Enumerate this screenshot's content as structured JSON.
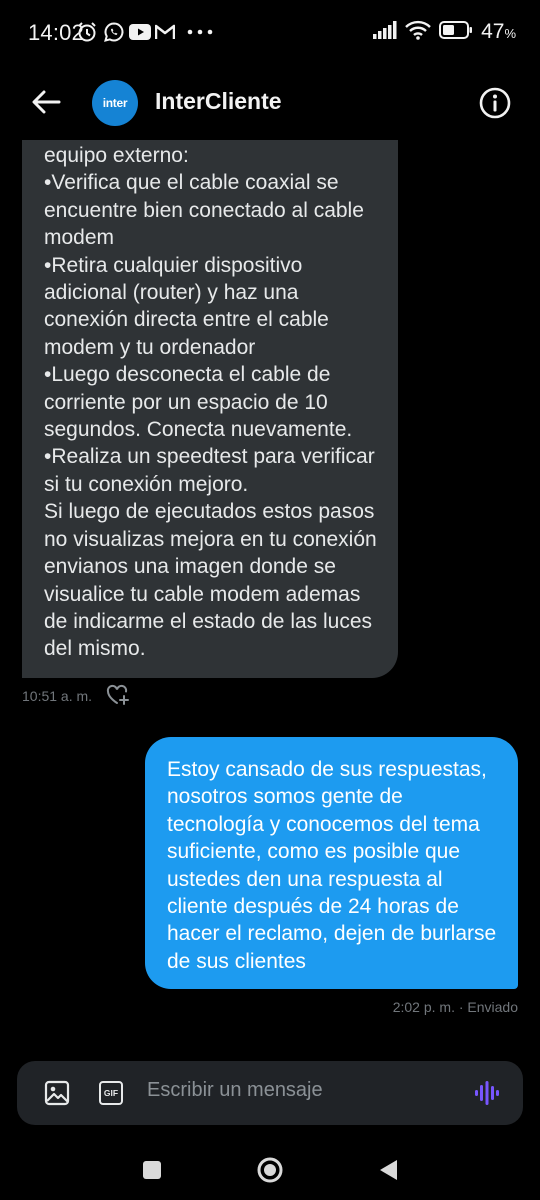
{
  "status_bar": {
    "time": "14:02",
    "battery_percent": "47",
    "notification_icons": [
      "alarm-icon",
      "whatsapp-icon",
      "youtube-icon",
      "gmail-icon",
      "more-dots-icon"
    ],
    "system_icons": [
      "signal-icon",
      "wifi-icon",
      "battery-icon"
    ]
  },
  "header": {
    "contact_name": "InterCliente",
    "avatar_text": "inter",
    "avatar_color": "#1583d4"
  },
  "messages": {
    "incoming": {
      "lines": [
        "equipo externo:",
        "•Verifica que el cable coaxial se",
        "encuentre bien conectado al cable",
        "modem",
        "•Retira cualquier dispositivo",
        "adicional (router) y haz una",
        "conexión directa entre el cable",
        "modem y tu ordenador",
        "•Luego desconecta el cable de",
        "corriente por un espacio de 10",
        "segundos. Conecta nuevamente.",
        "•Realiza un speedtest para verificar",
        "si tu conexión mejoro.",
        "Si luego de ejecutados estos pasos",
        "no visualizas mejora en tu conexión",
        "envianos una imagen donde se",
        "visualice tu cable modem ademas",
        "de indicarme el estado de las luces",
        "del mismo."
      ],
      "time": "10:51 a. m."
    },
    "outgoing": {
      "lines": [
        "Estoy cansado de sus respuestas,",
        "nosotros somos gente de",
        "tecnología y conocemos del tema",
        "suficiente, como es posible que",
        "ustedes den una respuesta al",
        "cliente después de 24 horas de",
        "hacer el reclamo, dejen de burlarse",
        "de sus clientes"
      ],
      "meta": "2:02 p. m. · Enviado"
    }
  },
  "composer": {
    "placeholder": "Escribir un mensaje",
    "gif_label": "GIF"
  },
  "colors": {
    "background": "#000000",
    "incoming_bubble": "#2f3336",
    "outgoing_bubble": "#1d9bf0",
    "composer_bg": "#202327",
    "voice_accent": "#7856ff"
  }
}
